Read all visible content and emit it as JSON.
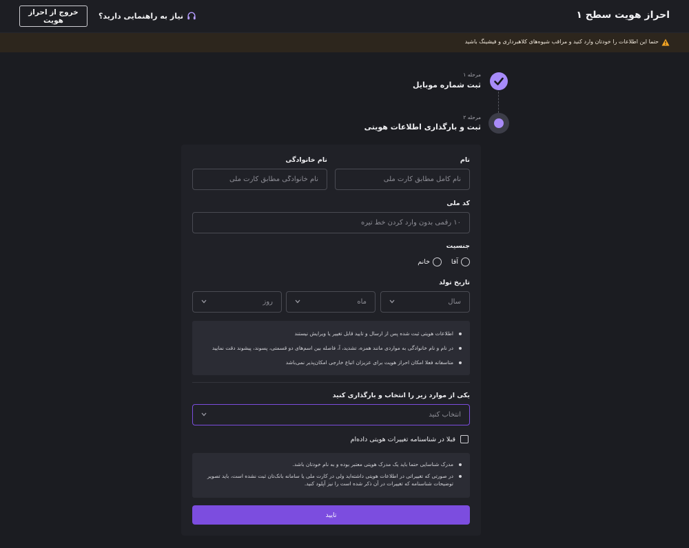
{
  "header": {
    "title": "احراز هویت سطح ۱",
    "exit_label": "خروج از احراز هویت",
    "help_label": "نیاز به راهنمایی دارید؟",
    "help_icon": "headphones-icon"
  },
  "warning": {
    "text": "حتما این اطلاعات را خودتان وارد کنید و مراقب شیوه‌های کلاهبرداری و فیشینگ باشید",
    "icon": "warning-triangle-icon",
    "color": "#f5a623"
  },
  "steps": [
    {
      "caption": "مرحله ۱",
      "label": "ثبت شماره موبایل",
      "status": "done"
    },
    {
      "caption": "مرحله ۲",
      "label": "ثبت و بارگذاری اطلاعات هویتی",
      "status": "active"
    }
  ],
  "form": {
    "first_name": {
      "label": "نام",
      "placeholder": "نام کامل مطابق کارت ملی"
    },
    "last_name": {
      "label": "نام خانوادگی",
      "placeholder": "نام خانوادگی مطابق کارت ملی"
    },
    "national_code": {
      "label": "کد ملی",
      "placeholder": "۱۰ رقمی بدون وارد کردن خط تیره"
    },
    "gender": {
      "label": "جنسیت",
      "options": [
        "آقا",
        "خانم"
      ]
    },
    "birth_date": {
      "label": "تاریخ تولد",
      "day": "روز",
      "month": "ماه",
      "year": "سال"
    },
    "notes1": [
      "اطلاعات هویتی ثبت شده پس از ارسال و تایید قابل تغییر یا ویرایش نیستند",
      "در نام و نام خانوادگی به مواردی مانند همزه، تشدید، آ، فاصله بین اسم‌های دو قسمتی، پسوند، پیشوند دقت نمایید",
      "متاسفانه فعلا امکان احراز هویت برای عزیزان اتباع خارجی امکان‌پذیر نمی‌باشد"
    ],
    "document": {
      "label": "یکی از موارد زیر را انتخاب و بارگذاری کنید",
      "placeholder": "انتخاب کنید"
    },
    "changed_checkbox_label": "قبلا در شناسنامه تغییرات هویتی داده‌ام",
    "notes2": [
      "مدرک شناسایی حتما باید یک مدرک هویتی معتبر بوده و به نام خودتان باشد.",
      "در صورتی که تغییراتی در اطلاعات هویتی داشته‌اید ولی در کارت ملی یا سامانه بانک‌تان ثبت نشده است، باید تصویر توضیحات شناسنامه که تغییرات در آن ذکر شده است را نیز آپلود کنید."
    ],
    "submit_label": "تایید",
    "accent": "#7c4ddf"
  }
}
